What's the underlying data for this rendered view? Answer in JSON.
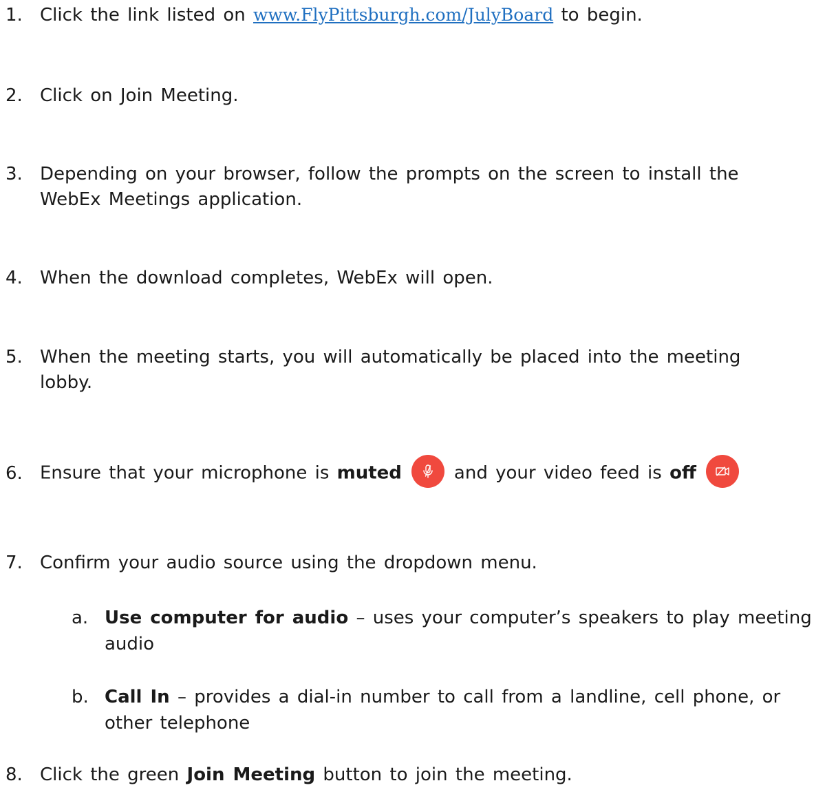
{
  "steps": [
    {
      "num": "1.",
      "before": "Click the link listed on",
      "link": "www.FlyPittsburgh.com/JulyBoard",
      "after": "to begin."
    },
    {
      "num": "2.",
      "text": "Click on Join Meeting."
    },
    {
      "num": "3.",
      "line1": "Depending on your browser, follow the prompts on the screen to install the",
      "line2": "WebEx Meetings application."
    },
    {
      "num": "4.",
      "text": "When the download completes, WebEx will open."
    },
    {
      "num": "5.",
      "line1": "When the meeting starts, you will automatically be placed into the meeting",
      "line2": "lobby."
    },
    {
      "num": "6.",
      "part1": "Ensure that your microphone is",
      "bold1": "muted",
      "part2": "and your video feed is",
      "bold2": "off",
      "icon1": "muted-microphone-icon",
      "icon2": "video-off-icon"
    },
    {
      "num": "7.",
      "text": "Confirm your audio source using the dropdown menu."
    },
    {
      "num": "8.",
      "part1": "Click the green",
      "bold": "Join Meeting",
      "part2": "button to join the meeting."
    }
  ],
  "substeps": [
    {
      "letter": "a.",
      "bold": "Use computer for audio",
      "line1": " – uses your computer’s speakers to play meeting",
      "line2": "audio"
    },
    {
      "letter": "b.",
      "bold": "Call In",
      "line1": " – provides a dial-in number to call from a landline, cell phone, or",
      "line2": "other telephone"
    }
  ],
  "colors": {
    "link": "#1f6fc0",
    "icon_background": "#f0493e",
    "text": "#1a1a1a"
  }
}
